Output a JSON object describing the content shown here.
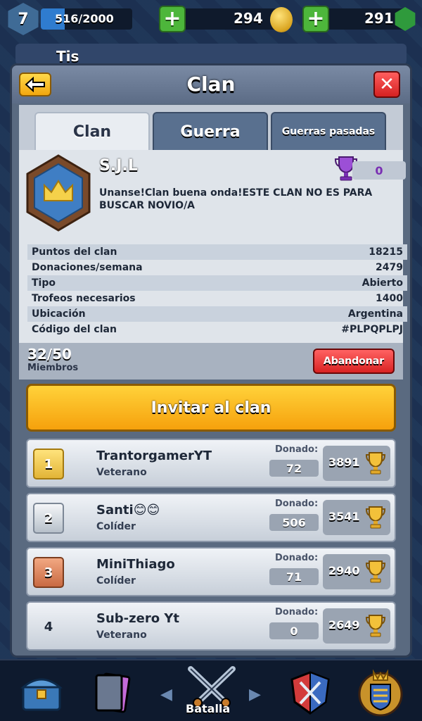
{
  "topbar": {
    "level": "7",
    "xp_text": "516/2000",
    "xp_fraction": 0.258,
    "gold": "294",
    "gems": "291"
  },
  "underlay": {
    "title": "Tis"
  },
  "panel": {
    "title": "Clan",
    "tabs": [
      {
        "label": "Clan",
        "active": true
      },
      {
        "label": "Guerra",
        "active": false
      },
      {
        "label": "Guerras pasadas",
        "active": false
      }
    ]
  },
  "clan": {
    "name": "S.J.L",
    "trophies": "0",
    "description": "Unanse!Clan buena onda!ESTE CLAN NO ES PARA BUSCAR NOVIO/A",
    "stats": [
      {
        "label": "Puntos del clan",
        "value": "18215"
      },
      {
        "label": "Donaciones/semana",
        "value": "2479"
      },
      {
        "label": "Tipo",
        "value": "Abierto"
      },
      {
        "label": "Trofeos necesarios",
        "value": "1400"
      },
      {
        "label": "Ubicación",
        "value": "Argentina"
      },
      {
        "label": "Código del clan",
        "value": "#PLPQPLPJ"
      }
    ]
  },
  "members_bar": {
    "count": "32/50",
    "label": "Miembros",
    "leave_label": "Abandonar"
  },
  "invite_label": "Invitar al clan",
  "donated_label": "Donado:",
  "members": [
    {
      "rank": "1",
      "name": "TrantorgamerYT",
      "role": "Veterano",
      "donated": "72",
      "trophies": "3891"
    },
    {
      "rank": "2",
      "name": "Santi😊😊",
      "role": "Colíder",
      "donated": "506",
      "trophies": "3541"
    },
    {
      "rank": "3",
      "name": "MiniThiago",
      "role": "Colíder",
      "donated": "71",
      "trophies": "2940"
    },
    {
      "rank": "4",
      "name": "Sub-zero Yt",
      "role": "Veterano",
      "donated": "0",
      "trophies": "2649"
    }
  ],
  "bottom_nav": {
    "battle_label": "Batalla"
  },
  "colors": {
    "accent_gold": "#f6a10c",
    "danger_red": "#d92323",
    "trophy_gold": "#e2a92a",
    "clan_trophy_purple": "#7a2fb3"
  }
}
